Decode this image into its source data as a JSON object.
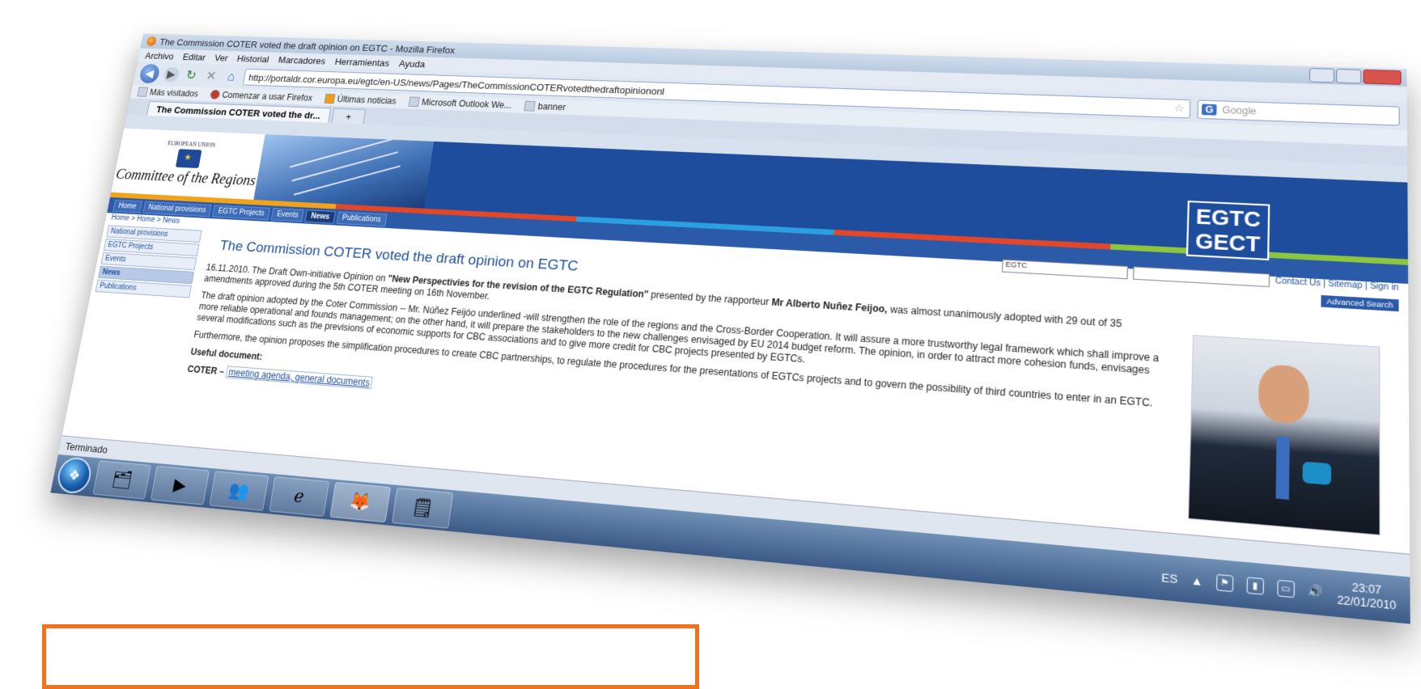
{
  "browser": {
    "title": "The Commission COTER voted the draft opinion on EGTC - Mozilla Firefox",
    "menu": [
      "Archivo",
      "Editar",
      "Ver",
      "Historial",
      "Marcadores",
      "Herramientas",
      "Ayuda"
    ],
    "url": "http://portaldr.cor.europa.eu/egtc/en-US/news/Pages/TheCommissionCOTERvotedthedraftopiniononl",
    "search_placeholder": "Google",
    "bookmarks": [
      "Más visitados",
      "Comenzar a usar Firefox",
      "Últimas noticias",
      "Microsoft Outlook We...",
      "banner"
    ],
    "tab_label": "The Commission COTER voted the dr...",
    "new_tab": "+",
    "status": "Terminado"
  },
  "site": {
    "eu_label": "EUROPEAN UNION",
    "logo_name": "Committee of the Regions",
    "egtc_line1": "EGTC",
    "egtc_line2": "GECT",
    "nav": [
      "Home",
      "National provisions",
      "EGTC Projects",
      "Events",
      "News",
      "Publications"
    ],
    "breadcrumb": "Home > Home > News",
    "left_nav": [
      "National provisions",
      "EGTC Projects",
      "Events",
      "News",
      "Publications"
    ],
    "search_scope": "EGTC",
    "top_links": "Contact Us | Sitemap | Sign in",
    "advanced_search": "Advanced Search",
    "stripe_colors": [
      "#f2a31c",
      "#e2472a",
      "#2b9fe0",
      "#e2472a",
      "#8cc63f"
    ]
  },
  "article": {
    "title": "The Commission COTER voted the draft opinion on EGTC",
    "p1_pre": "16.11.2010. The Draft Own-initiative Opinion on ",
    "p1_bold": "\"New Perspectivies for the revision of the EGTC Regulation\"",
    "p1_mid": " presented by the rapporteur ",
    "p1_bold2": "Mr Alberto Nuñez Feijoo,",
    "p1_post": " was almost unanimously adopted with 29 out of 35 amendments approved during the 5th COTER meeting on 16th November.",
    "p2": "The draft opinion adopted by the Coter Commission -- Mr. Núñez Feijóo underlined -will strengthen the role of the regions and the Cross-Border Cooperation. It will assure a more trustworthy legal framework which shall improve a more reliable operational and founds management; on the other hand, it will prepare the stakeholders to the new challenges envisaged by EU 2014 budget reform. The opinion, in order to attract more cohesion funds, envisages several modifications such as the previsions of economic supports for CBC associations and to give more credit for CBC projects presented by EGTCs.",
    "p3": "Furthermore, the opinion proposes the simplification procedures to create CBC partnerships, to regulate the procedures for the presentations of EGTCs projects and to govern the possibility of third countries to enter in an EGTC.",
    "useful_label": "Useful document:",
    "coter_prefix": "COTER –",
    "doc_link": "meeting agenda, general documents"
  },
  "taskbar": {
    "language": "ES",
    "time": "23:07",
    "date": "22/01/2010",
    "apps": [
      "folder-icon",
      "media-player-icon",
      "messenger-icon",
      "internet-explorer-icon",
      "firefox-icon",
      "notepad-icon"
    ]
  }
}
